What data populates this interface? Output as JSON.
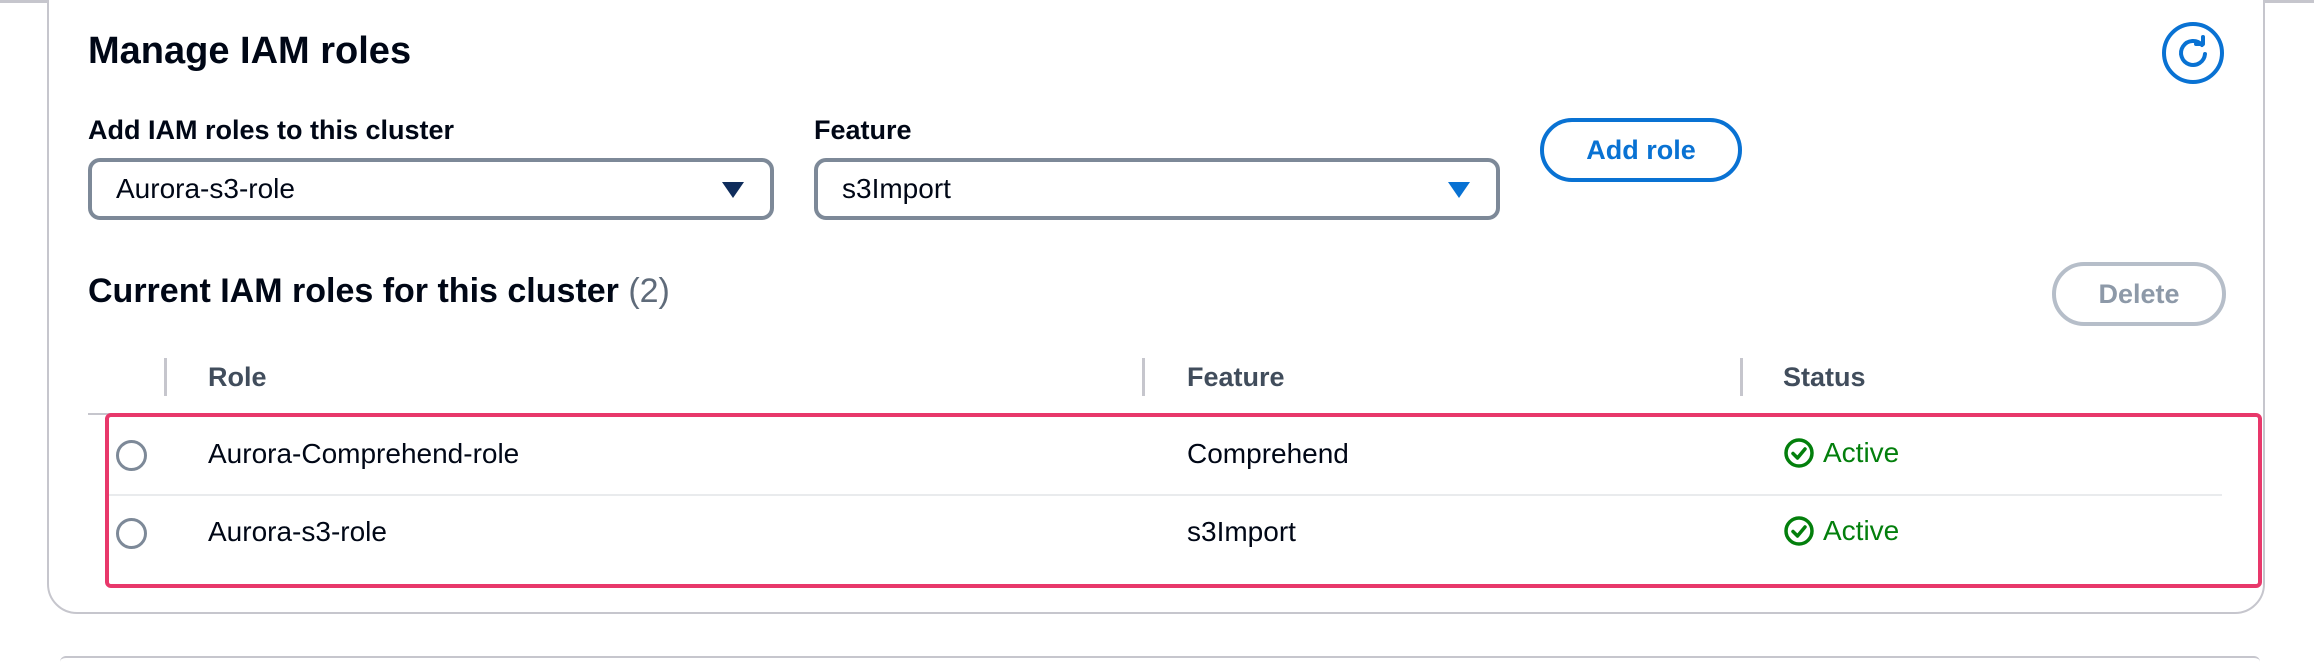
{
  "panel": {
    "title": "Manage IAM roles",
    "refresh_icon": "refresh-icon"
  },
  "form": {
    "role_label": "Add IAM roles to this cluster",
    "role_value": "Aurora-s3-role",
    "feature_label": "Feature",
    "feature_value": "s3Import",
    "add_button": "Add role"
  },
  "current": {
    "title": "Current IAM roles for this cluster",
    "count": "(2)",
    "delete_button": "Delete"
  },
  "table": {
    "columns": [
      "Role",
      "Feature",
      "Status"
    ],
    "rows": [
      {
        "role": "Aurora-Comprehend-role",
        "feature": "Comprehend",
        "status": "Active"
      },
      {
        "role": "Aurora-s3-role",
        "feature": "s3Import",
        "status": "Active"
      }
    ]
  },
  "colors": {
    "accent": "#0972d3",
    "status_active": "#037f0c",
    "highlight": "#e8386b",
    "caret_dark": "#0f2d5c"
  }
}
